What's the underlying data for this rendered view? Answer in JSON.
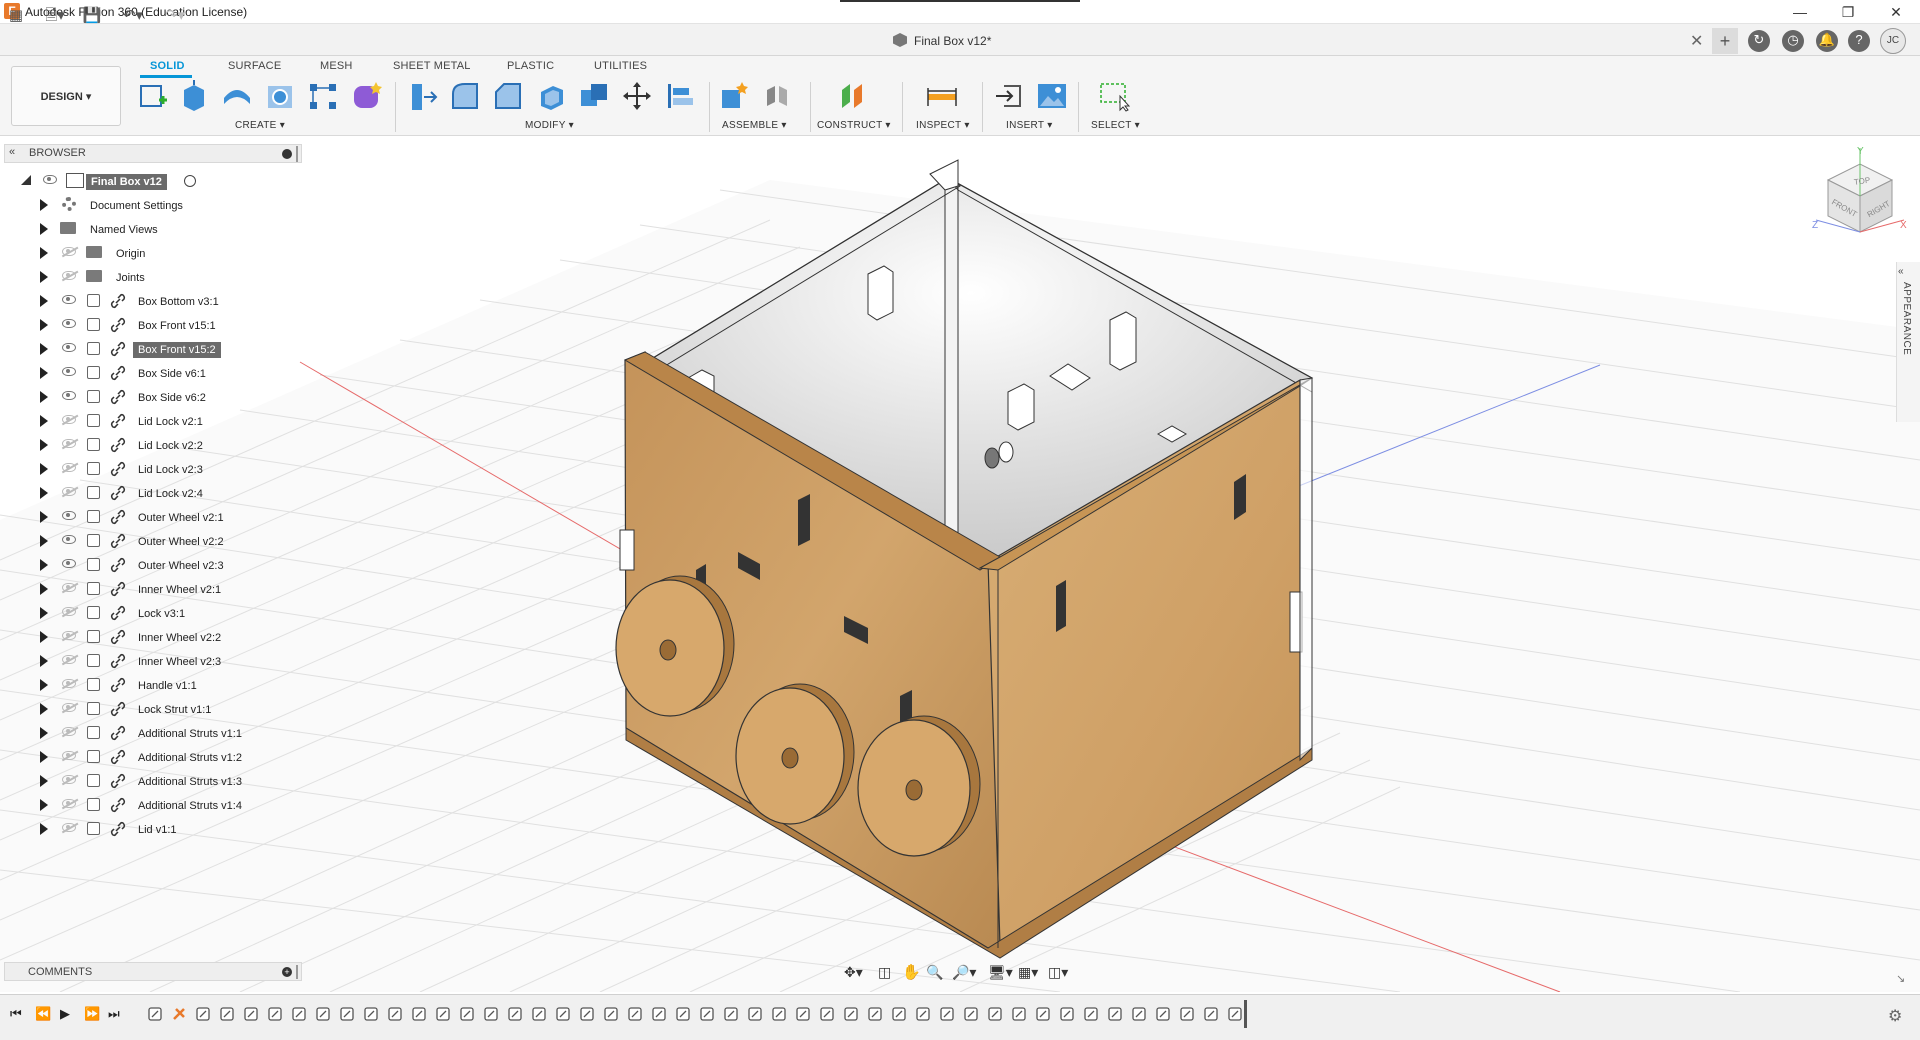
{
  "window": {
    "title": "Autodesk Fusion 360 (Education License)",
    "logo_letter": "F"
  },
  "document": {
    "tab_title": "Final Box v12*"
  },
  "ribbon": {
    "workspace_label": "DESIGN",
    "tabs": [
      "SOLID",
      "SURFACE",
      "MESH",
      "SHEET METAL",
      "PLASTIC",
      "UTILITIES"
    ],
    "active_tab": "SOLID",
    "groups": {
      "create": "CREATE",
      "modify": "MODIFY",
      "assemble": "ASSEMBLE",
      "construct": "CONSTRUCT",
      "inspect": "INSPECT",
      "insert": "INSERT",
      "select": "SELECT"
    }
  },
  "browser": {
    "title": "BROWSER",
    "root": "Final Box v12",
    "folders": [
      "Document Settings",
      "Named Views",
      "Origin",
      "Joints"
    ],
    "components": [
      {
        "label": "Box Bottom v3:1",
        "visible": true
      },
      {
        "label": "Box Front v15:1",
        "visible": true
      },
      {
        "label": "Box Front v15:2",
        "visible": true,
        "selected": true
      },
      {
        "label": "Box Side v6:1",
        "visible": true
      },
      {
        "label": "Box Side v6:2",
        "visible": true
      },
      {
        "label": "Lid Lock v2:1",
        "visible": false
      },
      {
        "label": "Lid Lock v2:2",
        "visible": false
      },
      {
        "label": "Lid Lock v2:3",
        "visible": false
      },
      {
        "label": "Lid Lock v2:4",
        "visible": false
      },
      {
        "label": "Outer Wheel v2:1",
        "visible": true
      },
      {
        "label": "Outer Wheel v2:2",
        "visible": true
      },
      {
        "label": "Outer Wheel v2:3",
        "visible": true
      },
      {
        "label": "Inner Wheel v2:1",
        "visible": false
      },
      {
        "label": "Lock v3:1",
        "visible": false
      },
      {
        "label": "Inner Wheel v2:2",
        "visible": false
      },
      {
        "label": "Inner Wheel v2:3",
        "visible": false
      },
      {
        "label": "Handle v1:1",
        "visible": false
      },
      {
        "label": "Lock Strut v1:1",
        "visible": false
      },
      {
        "label": "Additional Struts v1:1",
        "visible": false
      },
      {
        "label": "Additional Struts v1:2",
        "visible": false
      },
      {
        "label": "Additional Struts v1:3",
        "visible": false
      },
      {
        "label": "Additional Struts v1:4",
        "visible": false
      },
      {
        "label": "Lid v1:1",
        "visible": false
      }
    ]
  },
  "comments": {
    "title": "COMMENTS"
  },
  "viewcube": {
    "top": "TOP",
    "front": "FRONT",
    "right": "RIGHT",
    "x": "X",
    "y": "Y",
    "z": "Z"
  },
  "side_panel": {
    "appearance": "APPEARANCE"
  },
  "user": {
    "initials": "JC"
  },
  "colors": {
    "accent": "#0696d7",
    "wood": "#c9995a",
    "selected_row": "#6b6b6b"
  }
}
